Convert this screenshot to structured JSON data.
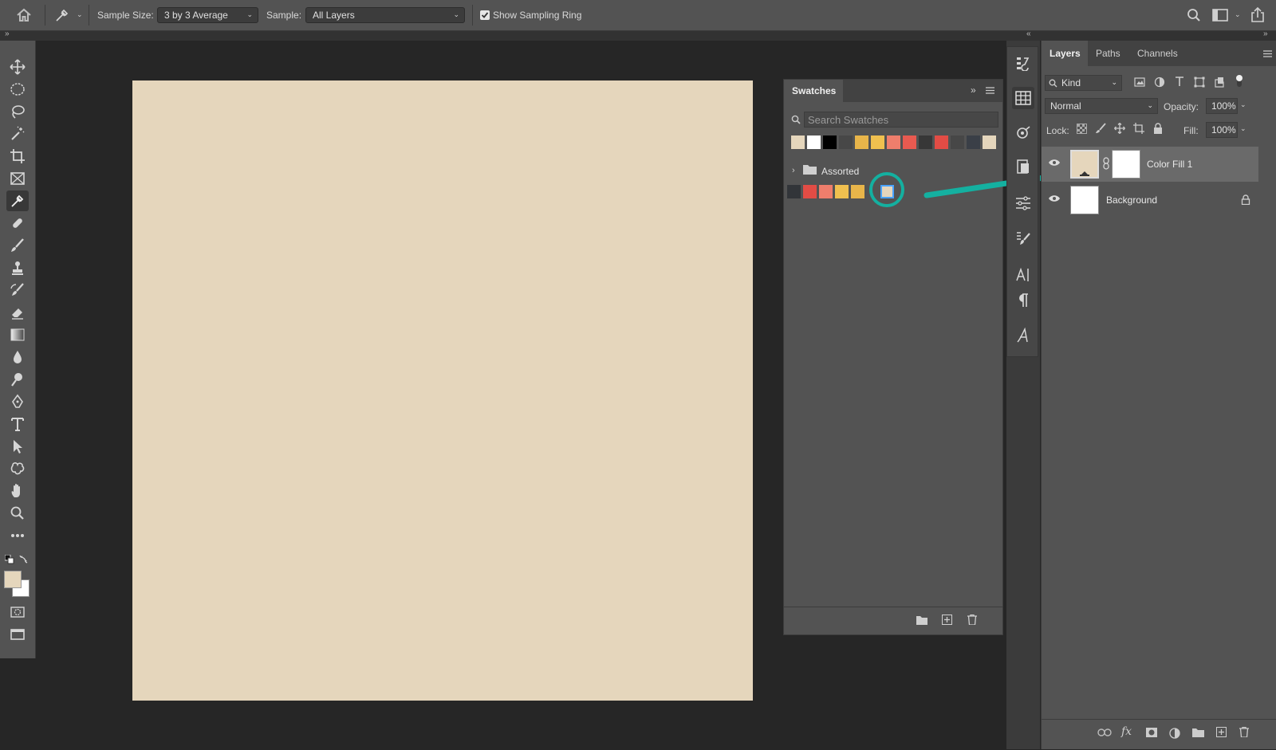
{
  "options_bar": {
    "sample_size_label": "Sample Size:",
    "sample_size_value": "3 by 3 Average",
    "sample_label": "Sample:",
    "sample_value": "All Layers",
    "show_sampling_ring_label": "Show Sampling Ring",
    "show_sampling_ring_checked": true,
    "icons": [
      "home-icon",
      "eyedropper-icon",
      "search-icon",
      "workspace-icon",
      "share-icon"
    ]
  },
  "toolbar": {
    "tools": [
      "move-tool",
      "elliptical-marquee-tool",
      "lasso-tool",
      "magic-wand-tool",
      "crop-tool",
      "frame-tool",
      "eyedropper-tool",
      "healing-brush-tool",
      "brush-tool",
      "clone-stamp-tool",
      "history-brush-tool",
      "eraser-tool",
      "gradient-tool",
      "blur-tool",
      "dodge-tool",
      "pen-tool",
      "type-tool",
      "path-selection-tool",
      "custom-shape-tool",
      "hand-tool",
      "zoom-tool",
      "more-tools",
      "quick-mask",
      "screen-mode"
    ],
    "active_tool": "eyedropper-tool",
    "foreground_color": "#e5d6bc",
    "background_color": "#ffffff"
  },
  "canvas": {
    "fill_color": "#e5d6bc"
  },
  "swatches_panel": {
    "title": "Swatches",
    "search_placeholder": "Search Swatches",
    "recent_colors": [
      "#e5d6bc",
      "#ffffff",
      "#000000",
      "#474747",
      "#e8b54a",
      "#f0c04f",
      "#ee7e6c",
      "#e85a50",
      "#373737",
      "#e24c45",
      "#474747",
      "#3a3f47",
      "#e5d6bc"
    ],
    "group_name": "Assorted",
    "group_colors": [
      "#323539",
      "#e24c45",
      "#ee7e6c",
      "#f0c04f",
      "#e8b54a"
    ],
    "highlighted_color": "#e5d6bc",
    "icons": [
      "new-group-icon",
      "new-swatch-icon",
      "delete-swatch-icon"
    ]
  },
  "layers_panel": {
    "tabs": [
      "Layers",
      "Paths",
      "Channels"
    ],
    "active_tab": "Layers",
    "filter_kind": "Kind",
    "blend_mode": "Normal",
    "opacity_label": "Opacity:",
    "opacity_value": "100%",
    "lock_label": "Lock:",
    "fill_label": "Fill:",
    "fill_value": "100%",
    "layers": [
      {
        "name": "Color Fill 1",
        "fill": "#e5d6bc",
        "selected": true
      },
      {
        "name": "Background",
        "fill": "#ffffff",
        "selected": false
      }
    ],
    "bottom_icons": [
      "link-icon",
      "fx-icon",
      "mask-icon",
      "adjustment-icon",
      "group-icon",
      "new-layer-icon",
      "delete-icon"
    ]
  },
  "annotation": {
    "color": "#14b0a0"
  }
}
